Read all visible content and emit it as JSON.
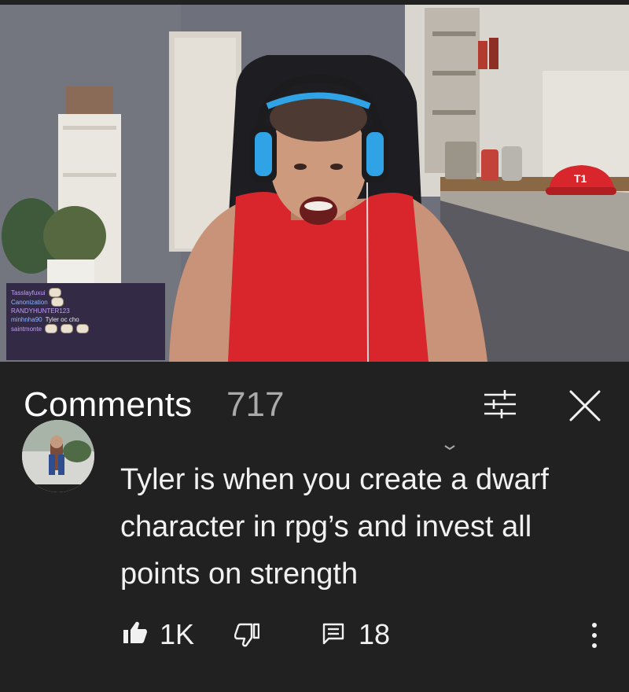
{
  "video": {
    "chat": [
      {
        "user": "Tasslayfuxui",
        "message": ""
      },
      {
        "user": "Canonization",
        "message": ""
      },
      {
        "user": "RANDYHUNTER123",
        "message": ""
      },
      {
        "user": "minhnha90",
        "message": "Tyler oc cho"
      },
      {
        "user": "saintmonte",
        "message": ""
      }
    ],
    "cap_logo": "T1"
  },
  "comments": {
    "title": "Comments",
    "count": "717",
    "icons": {
      "filter": "sort-filter-icon",
      "close": "close-icon"
    }
  },
  "comment": {
    "text": "Tyler is when you create a dwarf character in rpg’s and invest all points on strength",
    "likes": "1K",
    "replies": "18"
  },
  "colors": {
    "background": "#212121",
    "text": "#f1f1f1",
    "count": "#aaaaaa",
    "shirt": "#d8262c",
    "headset": "#2fa3e6"
  }
}
